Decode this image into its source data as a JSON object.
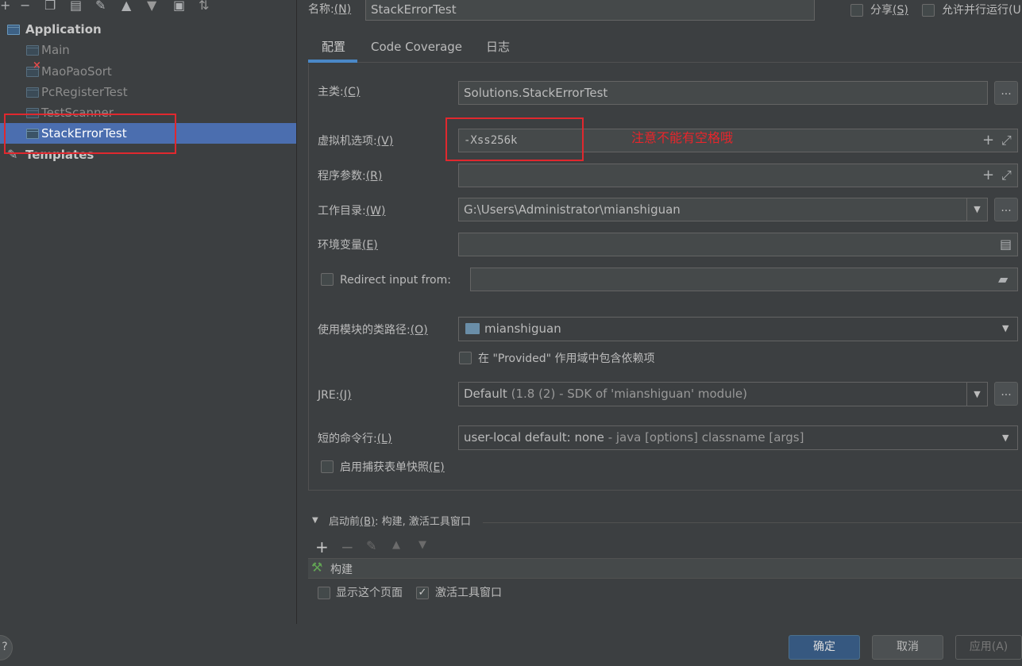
{
  "tree": {
    "group_label": "Application",
    "items": [
      {
        "label": "Main"
      },
      {
        "label": "MaoPaoSort"
      },
      {
        "label": "PcRegisterTest"
      },
      {
        "label": "TestScanner"
      },
      {
        "label": "StackErrorTest"
      }
    ],
    "templates_label": "Templates"
  },
  "header": {
    "name_label": "名称:",
    "name_mnemonic": "(N)",
    "name_value": "StackErrorTest",
    "share_label": "分享",
    "share_mnemonic": "(S)",
    "parallel_label": "允许并行运行",
    "parallel_mnemonic": "(U"
  },
  "tabs": [
    "配置",
    "Code Coverage",
    "日志"
  ],
  "form": {
    "main_class_label": "主类:",
    "main_class_mn": "(C)",
    "main_class_value": "Solutions.StackErrorTest",
    "vm_label": "虚拟机选项:",
    "vm_mn": "(V)",
    "vm_value": "-Xss256k",
    "program_label": "程序参数:",
    "program_mn": "(R)",
    "workdir_label": "工作目录:",
    "workdir_mn": "(W)",
    "workdir_value": "G:\\Users\\Administrator\\mianshiguan",
    "env_label": "环境变量",
    "env_mn": "(E)",
    "redirect_label": "Redirect input from:",
    "module_label": "使用模块的类路径:",
    "module_mn": "(O)",
    "module_value": "mianshiguan",
    "provided_label": "在 \"Provided\" 作用域中包含依赖项",
    "jre_label": "JRE:",
    "jre_mn": "(J)",
    "jre_value_main": "Default",
    "jre_value_detail": "(1.8 (2) - SDK of 'mianshiguan' module)",
    "shortcmd_label": "短的命令行:",
    "shortcmd_mn": "(L)",
    "shortcmd_value_main": "user-local default: none",
    "shortcmd_value_detail": "- java [options] classname [args]",
    "snapshot_label": "启用捕获表单快照",
    "snapshot_mn": "(E)",
    "ellipsis": "..."
  },
  "annotation": "注意不能有空格哦",
  "before_launch": {
    "title": "启动前",
    "title_mn": "(B)",
    "title_rest": ": 构建, 激活工具窗口",
    "item": "构建",
    "show_page_label": "显示这个页面",
    "activate_label": "激活工具窗口"
  },
  "footer": {
    "ok": "确定",
    "cancel": "取消",
    "apply": "应用(A)",
    "help": "?"
  },
  "colors": {
    "accent": "#4b6eaf",
    "annotation_red": "#e0282e",
    "background": "#3c3f41"
  }
}
